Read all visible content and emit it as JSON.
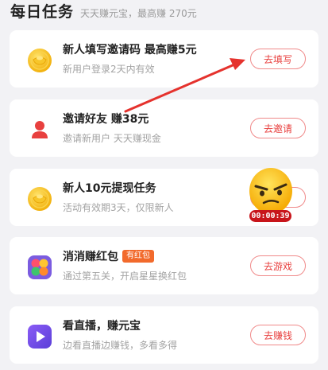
{
  "header": {
    "title": "每日任务",
    "subtitle": "天天赚元宝，最高赚 270元"
  },
  "tasks": [
    {
      "title": "新人填写邀请码 最高赚5元",
      "subtitle": "新用户登录2天内有效",
      "button": "去填写",
      "icon": "gold-coin-icon"
    },
    {
      "title": "邀请好友 赚38元",
      "subtitle": "邀请新用户 天天赚现金",
      "button": "去邀请",
      "icon": "person-icon"
    },
    {
      "title": "新人10元提现任务",
      "subtitle": "活动有效期3天，仅限新人",
      "button": "",
      "icon": "gold-coin-icon"
    },
    {
      "title": "消消赚红包",
      "tag": "有红包",
      "subtitle": "通过第五关，开启星星换红包",
      "button": "去游戏",
      "icon": "game-balls-icon"
    },
    {
      "title": "看直播，赚元宝",
      "subtitle": "边看直播边赚钱，多看多得",
      "button": "去赚钱",
      "icon": "play-icon"
    }
  ],
  "floating_widget": {
    "timer": "00:00:39",
    "icon": "angry-emoji-icon"
  },
  "colors": {
    "accent": "#e8403f",
    "tag": "#f26a2c",
    "background": "#f2f2f5"
  }
}
